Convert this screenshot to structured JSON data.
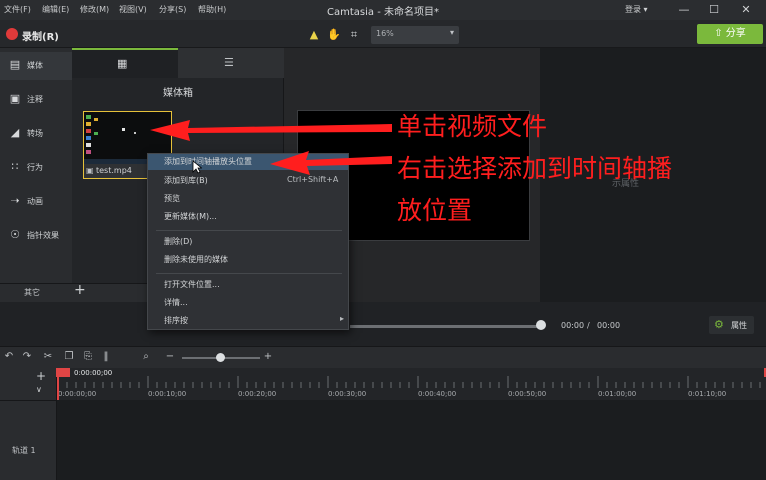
{
  "titlebar": {
    "menu": [
      "文件(F)",
      "编辑(E)",
      "修改(M)",
      "视图(V)",
      "分享(S)",
      "帮助(H)"
    ],
    "title": "Camtasia - 未命名项目*",
    "login": "登录 ▾",
    "window_buttons": {
      "minimize": "—",
      "maximize": "☐",
      "close": "✕"
    }
  },
  "toolbar": {
    "record_label": "录制(R)",
    "zoom_value": "16%",
    "share_label": "分享",
    "icons": [
      "pointer-icon",
      "hand-icon",
      "crop-icon"
    ]
  },
  "rail": {
    "items": [
      {
        "label": "媒体",
        "icon": "media-icon"
      },
      {
        "label": "注释",
        "icon": "annotation-icon"
      },
      {
        "label": "转场",
        "icon": "transition-icon"
      },
      {
        "label": "行为",
        "icon": "behavior-icon"
      },
      {
        "label": "动画",
        "icon": "animation-icon"
      },
      {
        "label": "指针效果",
        "icon": "cursor-effect-icon"
      }
    ],
    "other_label": "其它",
    "add_label": "+"
  },
  "bin": {
    "title": "媒体箱",
    "tabs": [
      "film-icon",
      "list-icon"
    ],
    "file_name": "test.mp4"
  },
  "canvas": {
    "ghost_text": "示属性"
  },
  "playback": {
    "current_time": "00:00",
    "separator": "/",
    "total_time": "00:00",
    "properties_label": "属性"
  },
  "timeline": {
    "playhead_time": "0:00:00;00",
    "ticks": [
      "0:00:00;00",
      "0:00:10;00",
      "0:00:20;00",
      "0:00:30;00",
      "0:00:40;00",
      "0:00:50;00",
      "0:01:00;00",
      "0:01:10;00"
    ],
    "track_label": "轨道 1"
  },
  "context_menu": {
    "items": [
      {
        "label": "添加到时间轴播放头位置",
        "shortcut": ""
      },
      {
        "label": "添加到库(B)",
        "shortcut": "Ctrl+Shift+A"
      },
      {
        "label": "预览",
        "shortcut": ""
      },
      {
        "label": "更新媒体(M)...",
        "shortcut": ""
      },
      {
        "label": "删除(D)",
        "shortcut": ""
      },
      {
        "label": "删除未使用的媒体",
        "shortcut": ""
      },
      {
        "label": "打开文件位置...",
        "shortcut": ""
      },
      {
        "label": "详情...",
        "shortcut": ""
      },
      {
        "label": "排序按",
        "shortcut": ""
      }
    ]
  },
  "annotations": {
    "line1": "单击视频文件",
    "line2": "右击选择添加到时间轴播",
    "line3": "放位置",
    "color": "#ff1e1e"
  },
  "colors": {
    "accent": "#7bb93c",
    "record": "#e03a3a",
    "playhead": "#e04545",
    "selection": "#e6c13a"
  }
}
